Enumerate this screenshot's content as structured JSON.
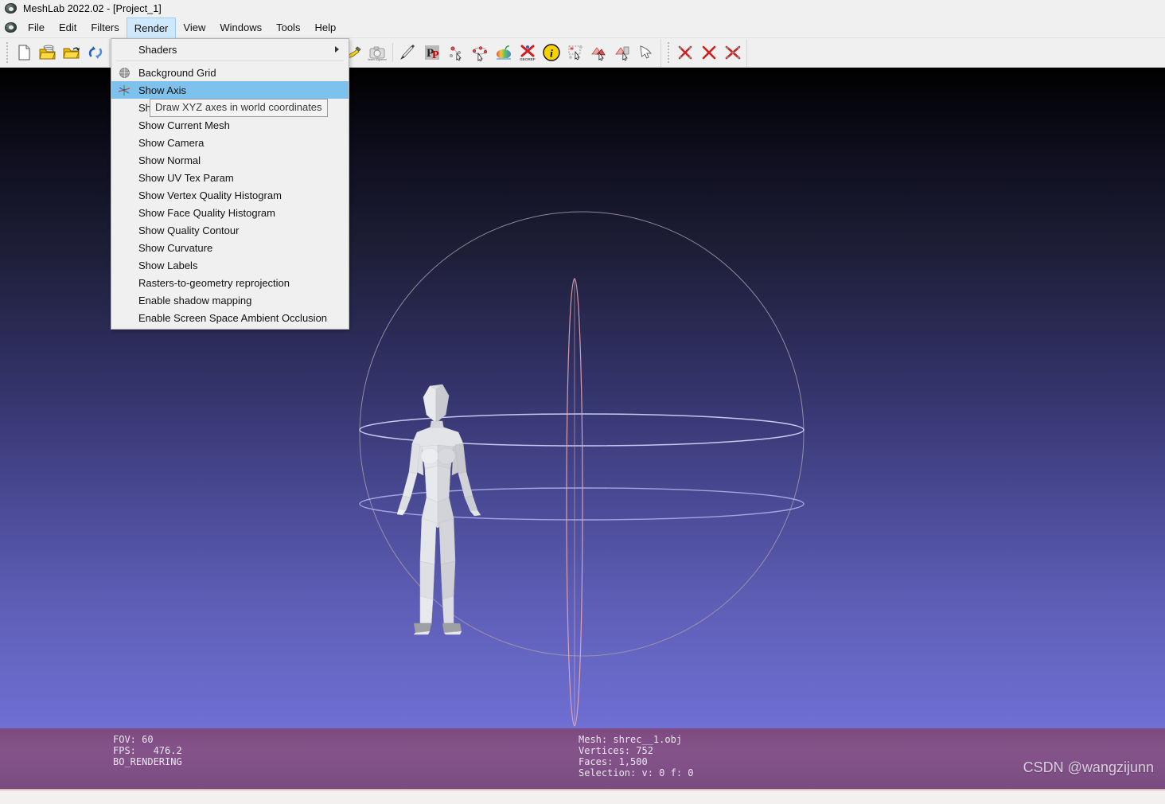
{
  "window": {
    "title": "MeshLab 2022.02 - [Project_1]",
    "logo_icon": "meshlab-logo-icon"
  },
  "menubar": {
    "items": [
      {
        "label": "File",
        "active": false
      },
      {
        "label": "Edit",
        "active": false
      },
      {
        "label": "Filters",
        "active": false
      },
      {
        "label": "Render",
        "active": true
      },
      {
        "label": "View",
        "active": false
      },
      {
        "label": "Windows",
        "active": false
      },
      {
        "label": "Tools",
        "active": false
      },
      {
        "label": "Help",
        "active": false
      }
    ],
    "active_highlight_color": "#cfe8fb"
  },
  "toolbar": {
    "groups": [
      {
        "buttons": [
          {
            "icon": "new-document-icon",
            "selected": false
          },
          {
            "icon": "open-project-icon",
            "selected": false
          },
          {
            "icon": "open-mesh-icon",
            "selected": false
          },
          {
            "icon": "reload-icon",
            "selected": false
          }
        ]
      },
      {
        "buttons": [
          {
            "icon": "save-icon",
            "selected": false
          },
          {
            "icon": "save-as-icon",
            "selected": false
          },
          {
            "icon": "snapshot-icon",
            "selected": true
          }
        ]
      },
      {
        "buttons": [
          {
            "icon": "layer-stack-icon",
            "selected": false
          },
          {
            "icon": "show-axis-icon",
            "selected": false
          }
        ]
      },
      {
        "buttons": [
          {
            "icon": "trackball-icon",
            "selected": false
          },
          {
            "icon": "text-label-icon",
            "selected": false
          },
          {
            "icon": "axes-gizmo-icon",
            "selected": false
          },
          {
            "icon": "measure-tool-icon",
            "selected": false
          },
          {
            "icon": "raster-align-icon",
            "selected": false
          },
          {
            "icon": "paint-brush-icon",
            "selected": false
          },
          {
            "icon": "pdf-export-icon",
            "selected": false
          },
          {
            "icon": "pick-points-icon",
            "selected": false
          },
          {
            "icon": "edit-points-icon",
            "selected": false
          },
          {
            "icon": "color-mesh-icon",
            "selected": false
          },
          {
            "icon": "georef-icon",
            "selected": false
          },
          {
            "icon": "info-icon",
            "selected": false
          },
          {
            "icon": "select-rect-icon",
            "selected": false
          },
          {
            "icon": "select-faces-icon",
            "selected": false
          },
          {
            "icon": "select-vertex-icon",
            "selected": false
          },
          {
            "icon": "select-connected-icon",
            "selected": false
          },
          {
            "icon": "select-arrow-icon",
            "selected": false
          }
        ]
      },
      {
        "buttons": [
          {
            "icon": "delete-faces-icon",
            "selected": false
          },
          {
            "icon": "delete-vertices-icon",
            "selected": false
          },
          {
            "icon": "delete-selected-faces-icon",
            "selected": false
          }
        ]
      }
    ]
  },
  "render_menu": {
    "entries": [
      {
        "label": "Shaders",
        "icon": null,
        "submenu": true,
        "highlight": false,
        "separator_after": true
      },
      {
        "label": "Background Grid",
        "icon": "background-grid-icon",
        "submenu": false,
        "highlight": false,
        "separator_after": false
      },
      {
        "label": "Show Axis",
        "icon": "show-axis-icon",
        "submenu": false,
        "highlight": true,
        "separator_after": false
      },
      {
        "label": "Show Quoted Box",
        "icon": null,
        "submenu": false,
        "highlight": false,
        "separator_after": false
      },
      {
        "label": "Show Current Mesh",
        "icon": null,
        "submenu": false,
        "highlight": false,
        "separator_after": false
      },
      {
        "label": "Show Camera",
        "icon": null,
        "submenu": false,
        "highlight": false,
        "separator_after": false
      },
      {
        "label": "Show Normal",
        "icon": null,
        "submenu": false,
        "highlight": false,
        "separator_after": false
      },
      {
        "label": "Show UV Tex Param",
        "icon": null,
        "submenu": false,
        "highlight": false,
        "separator_after": false
      },
      {
        "label": "Show Vertex Quality Histogram",
        "icon": null,
        "submenu": false,
        "highlight": false,
        "separator_after": false
      },
      {
        "label": "Show Face Quality Histogram",
        "icon": null,
        "submenu": false,
        "highlight": false,
        "separator_after": false
      },
      {
        "label": "Show Quality Contour",
        "icon": null,
        "submenu": false,
        "highlight": false,
        "separator_after": false
      },
      {
        "label": "Show Curvature",
        "icon": null,
        "submenu": false,
        "highlight": false,
        "separator_after": false
      },
      {
        "label": "Show Labels",
        "icon": null,
        "submenu": false,
        "highlight": false,
        "separator_after": false
      },
      {
        "label": "Rasters-to-geometry reprojection",
        "icon": null,
        "submenu": false,
        "highlight": false,
        "separator_after": false
      },
      {
        "label": "Enable shadow mapping",
        "icon": null,
        "submenu": false,
        "highlight": false,
        "separator_after": false
      },
      {
        "label": "Enable Screen Space Ambient Occlusion",
        "icon": null,
        "submenu": false,
        "highlight": false,
        "separator_after": false
      }
    ],
    "highlight_color": "#7ec1ed"
  },
  "tooltip": {
    "text": "Draw XYZ axes in world coordinates"
  },
  "viewport": {
    "mesh_name": "shrec__1.obj",
    "background_top_color": "#000000",
    "background_bottom_color": "#6f6fd4",
    "trackball_visible": true
  },
  "statusbar": {
    "left_lines": [
      "FOV: 60",
      "FPS:   476.2",
      "BO_RENDERING"
    ],
    "mid_lines": [
      "Mesh: shrec__1.obj",
      "Vertices: 752",
      "Faces: 1,500",
      "Selection: v: 0 f: 0"
    ],
    "fov": "60",
    "fps": "476.2",
    "render_mode": "BO_RENDERING",
    "mesh": "shrec__1.obj",
    "vertices": "752",
    "faces": "1,500",
    "selection": "v: 0 f: 0",
    "background_color": "#7d4a7e"
  },
  "watermark": {
    "text": "CSDN @wangzijunn"
  }
}
